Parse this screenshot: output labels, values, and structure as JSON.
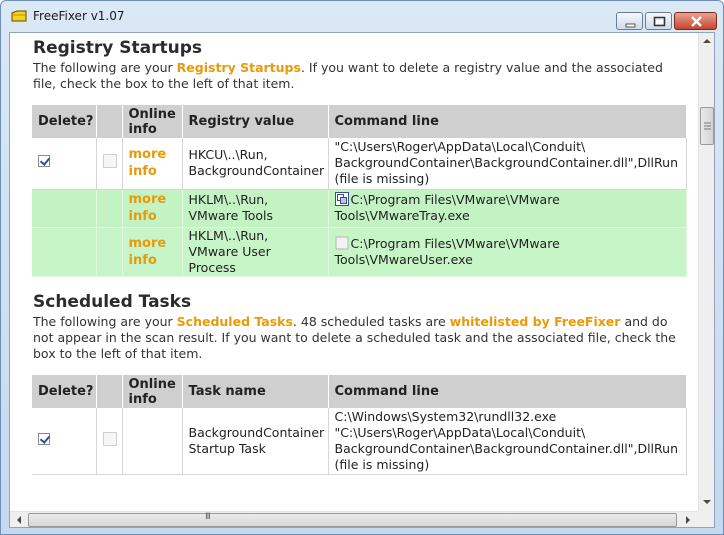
{
  "window": {
    "title": "FreeFixer v1.07"
  },
  "registry": {
    "heading": "Registry Startups",
    "intro_1": "The following are your ",
    "intro_hl": "Registry Startups",
    "intro_2": ". If you want to delete a registry value and the associated",
    "intro_3": "file, check the box to the left of that item.",
    "columns": {
      "delete": "Delete?",
      "online_1": "Online",
      "online_2": "info",
      "value": "Registry value",
      "cmd": "Command line"
    },
    "rows": [
      {
        "checked": true,
        "more_1": "more",
        "more_2": "info",
        "value_1": "HKCU\\..\\Run,",
        "value_2": "BackgroundContainer",
        "cmd_1": "\"C:\\Users\\Roger\\AppData\\Local\\Conduit\\",
        "cmd_2": "BackgroundContainer\\BackgroundContainer.dll\",DllRun",
        "cmd_3": "(file is missing)",
        "style": "white",
        "icon": ""
      },
      {
        "checked": false,
        "more_1": "more",
        "more_2": "info",
        "value_1": "HKLM\\..\\Run,",
        "value_2": "VMware Tools",
        "cmd_1": "C:\\Program Files\\VMware\\VMware",
        "cmd_2": "Tools\\VMwareTray.exe",
        "cmd_3": "",
        "style": "green",
        "icon": "vmware-tray-icon"
      },
      {
        "checked": false,
        "more_1": "more",
        "more_2": "info",
        "value_1": "HKLM\\..\\Run,",
        "value_2": "VMware User Process",
        "cmd_1": "C:\\Program Files\\VMware\\VMware",
        "cmd_2": "Tools\\VMwareUser.exe",
        "cmd_3": "",
        "style": "green2",
        "icon": "generic-exe-icon"
      }
    ]
  },
  "tasks": {
    "heading": "Scheduled Tasks",
    "intro_1": "The following are your ",
    "intro_hl": "Scheduled Tasks",
    "intro_2": ". 48 scheduled tasks are ",
    "intro_hl2": "whitelisted by FreeFixer",
    "intro_3": " and do",
    "intro_4": "not appear in the scan result. If you want to delete a scheduled task and the associated file, check the",
    "intro_5": "box to the left of that item.",
    "columns": {
      "delete": "Delete?",
      "online_1": "Online",
      "online_2": "info",
      "name": "Task name",
      "cmd": "Command line"
    },
    "rows": [
      {
        "checked": true,
        "name_1": "BackgroundContainer",
        "name_2": "Startup Task",
        "cmd_1": "C:\\Windows\\System32\\rundll32.exe",
        "cmd_2": "\"C:\\Users\\Roger\\AppData\\Local\\Conduit\\",
        "cmd_3": "BackgroundContainer\\BackgroundContainer.dll\",DllRun",
        "cmd_4": "(file is missing)"
      }
    ]
  },
  "scrollbar": {
    "grip_label": "III"
  }
}
